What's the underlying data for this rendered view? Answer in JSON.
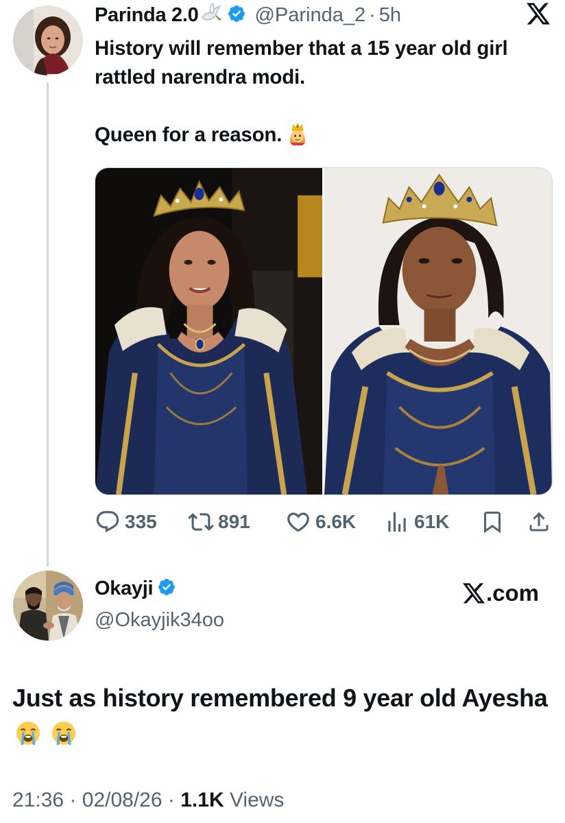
{
  "tweet1": {
    "display_name": "Parinda 2.0",
    "handle": "@Parinda_2",
    "separator": "·",
    "time": "5h",
    "text_line1": "History will remember that a 15 year old girl rattled narendra modi.",
    "text_line2": "Queen for a reason.",
    "emoji": "princess",
    "stats": {
      "replies": "335",
      "reposts": "891",
      "likes": "6.6K",
      "views": "61K"
    }
  },
  "tweet2": {
    "display_name": "Okayji",
    "handle": "@Okayjik34oo",
    "site_label": ".com",
    "text": "Just as history remembered 9 year old Ayesha",
    "emoji": "loudly-crying-face",
    "time": "21:36",
    "date": "02/08/26",
    "separator": "·",
    "views_count": "1.1K",
    "views_label": "Views"
  },
  "colors": {
    "text": "#0f1419",
    "secondary": "#536471",
    "verified": "#1d9bf0",
    "border": "#cfd9de"
  }
}
